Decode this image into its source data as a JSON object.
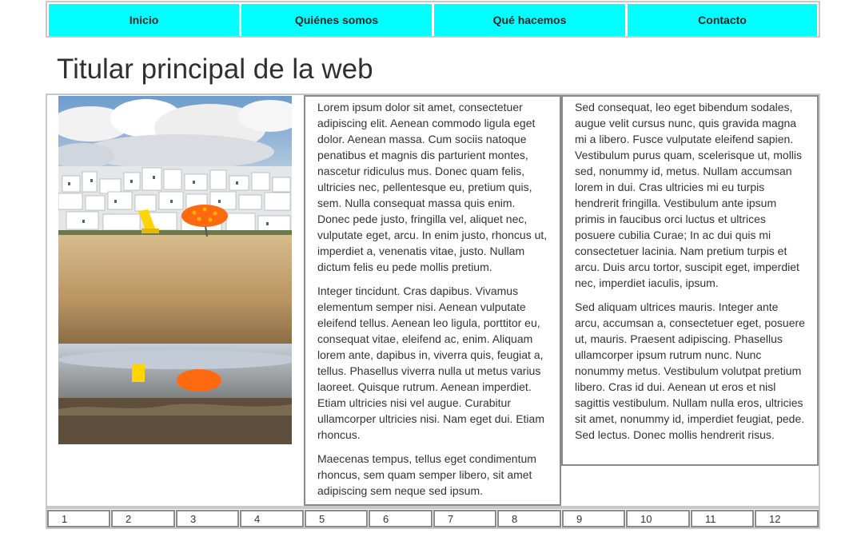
{
  "nav": {
    "items": [
      {
        "label": "Inicio"
      },
      {
        "label": "Quiénes somos"
      },
      {
        "label": "Qué hacemos"
      },
      {
        "label": "Contacto"
      }
    ]
  },
  "page": {
    "title": "Titular principal de la web"
  },
  "content": {
    "image": {
      "icon": "beach-photo",
      "colors": {
        "sky": "#8fb3d6",
        "sand": "#c9a877",
        "umbrella": "#ff6a10",
        "chair": "#ffd400"
      }
    },
    "column1": [
      "Lorem ipsum dolor sit amet, consectetuer adipiscing elit. Aenean commodo ligula eget dolor. Aenean massa. Cum sociis natoque penatibus et magnis dis parturient montes, nascetur ridiculus mus. Donec quam felis, ultricies nec, pellentesque eu, pretium quis, sem. Nulla consequat massa quis enim. Donec pede justo, fringilla vel, aliquet nec, vulputate eget, arcu. In enim justo, rhoncus ut, imperdiet a, venenatis vitae, justo. Nullam dictum felis eu pede mollis pretium.",
      "Integer tincidunt. Cras dapibus. Vivamus elementum semper nisi. Aenean vulputate eleifend tellus. Aenean leo ligula, porttitor eu, consequat vitae, eleifend ac, enim. Aliquam lorem ante, dapibus in, viverra quis, feugiat a, tellus. Phasellus viverra nulla ut metus varius laoreet. Quisque rutrum. Aenean imperdiet. Etiam ultricies nisi vel augue. Curabitur ullamcorper ultricies nisi. Nam eget dui. Etiam rhoncus.",
      "Maecenas tempus, tellus eget condimentum rhoncus, sem quam semper libero, sit amet adipiscing sem neque sed ipsum."
    ],
    "column2": [
      "Sed consequat, leo eget bibendum sodales, augue velit cursus nunc, quis gravida magna mi a libero. Fusce vulputate eleifend sapien. Vestibulum purus quam, scelerisque ut, mollis sed, nonummy id, metus. Nullam accumsan lorem in dui. Cras ultricies mi eu turpis hendrerit fringilla. Vestibulum ante ipsum primis in faucibus orci luctus et ultrices posuere cubilia Curae; In ac dui quis mi consectetuer lacinia. Nam pretium turpis et arcu. Duis arcu tortor, suscipit eget, imperdiet nec, imperdiet iaculis, ipsum.",
      "Sed aliquam ultrices mauris. Integer ante arcu, accumsan a, consectetuer eget, posuere ut, mauris. Praesent adipiscing. Phasellus ullamcorper ipsum rutrum nunc. Nunc nonummy metus. Vestibulum volutpat pretium libero. Cras id dui. Aenean ut eros et nisl sagittis vestibulum. Nullam nulla eros, ultricies sit amet, nonummy id, imperdiet feugiat, pede. Sed lectus. Donec mollis hendrerit risus."
    ]
  },
  "footer": {
    "cells": [
      "1",
      "2",
      "3",
      "4",
      "5",
      "6",
      "7",
      "8",
      "9",
      "10",
      "11",
      "12"
    ]
  },
  "colors": {
    "nav_bg": "#00ffff",
    "border_light": "#c8c8c8",
    "border_dark": "#8a8a8a"
  }
}
